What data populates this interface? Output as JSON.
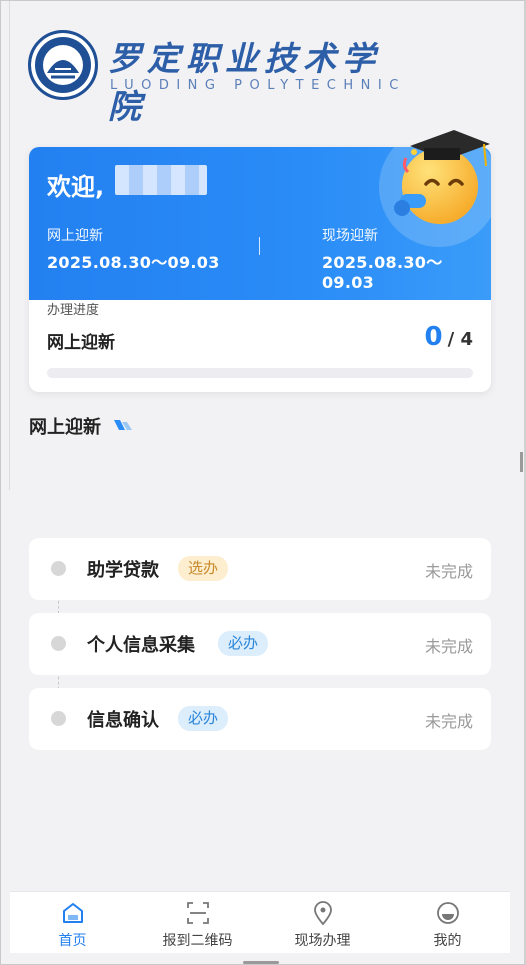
{
  "header": {
    "logo_cn": "罗定职业技术学院",
    "logo_en": "LUODING POLYTECHNIC"
  },
  "welcome_card": {
    "greeting": "欢迎,",
    "online": {
      "label": "网上迎新",
      "date_range": "2025.08.30～09.03"
    },
    "onsite": {
      "label": "现场迎新",
      "date_range": "2025.08.30～09.03"
    }
  },
  "progress": {
    "title": "办理进度",
    "name": "网上迎新",
    "done": "0",
    "total": "/ 4",
    "fraction": 0
  },
  "section": {
    "title": "网上迎新"
  },
  "steps": [
    {
      "name": "助学贷款",
      "tag": "选办",
      "status": "未完成"
    },
    {
      "name": "个人信息采集",
      "tag": "必办",
      "status": "未完成"
    },
    {
      "name": "信息确认",
      "tag": "必办",
      "status": "未完成"
    }
  ],
  "tabbar": {
    "items": [
      {
        "label": "首页",
        "icon": "home-icon",
        "active": true
      },
      {
        "label": "报到二维码",
        "icon": "scan-icon",
        "active": false
      },
      {
        "label": "现场办理",
        "icon": "location-icon",
        "active": false
      },
      {
        "label": "我的",
        "icon": "profile-icon",
        "active": false
      }
    ]
  },
  "colors": {
    "primary": "#2380f0",
    "optional_tag_bg": "#fdeecf",
    "required_tag_bg": "#dcedfc"
  }
}
